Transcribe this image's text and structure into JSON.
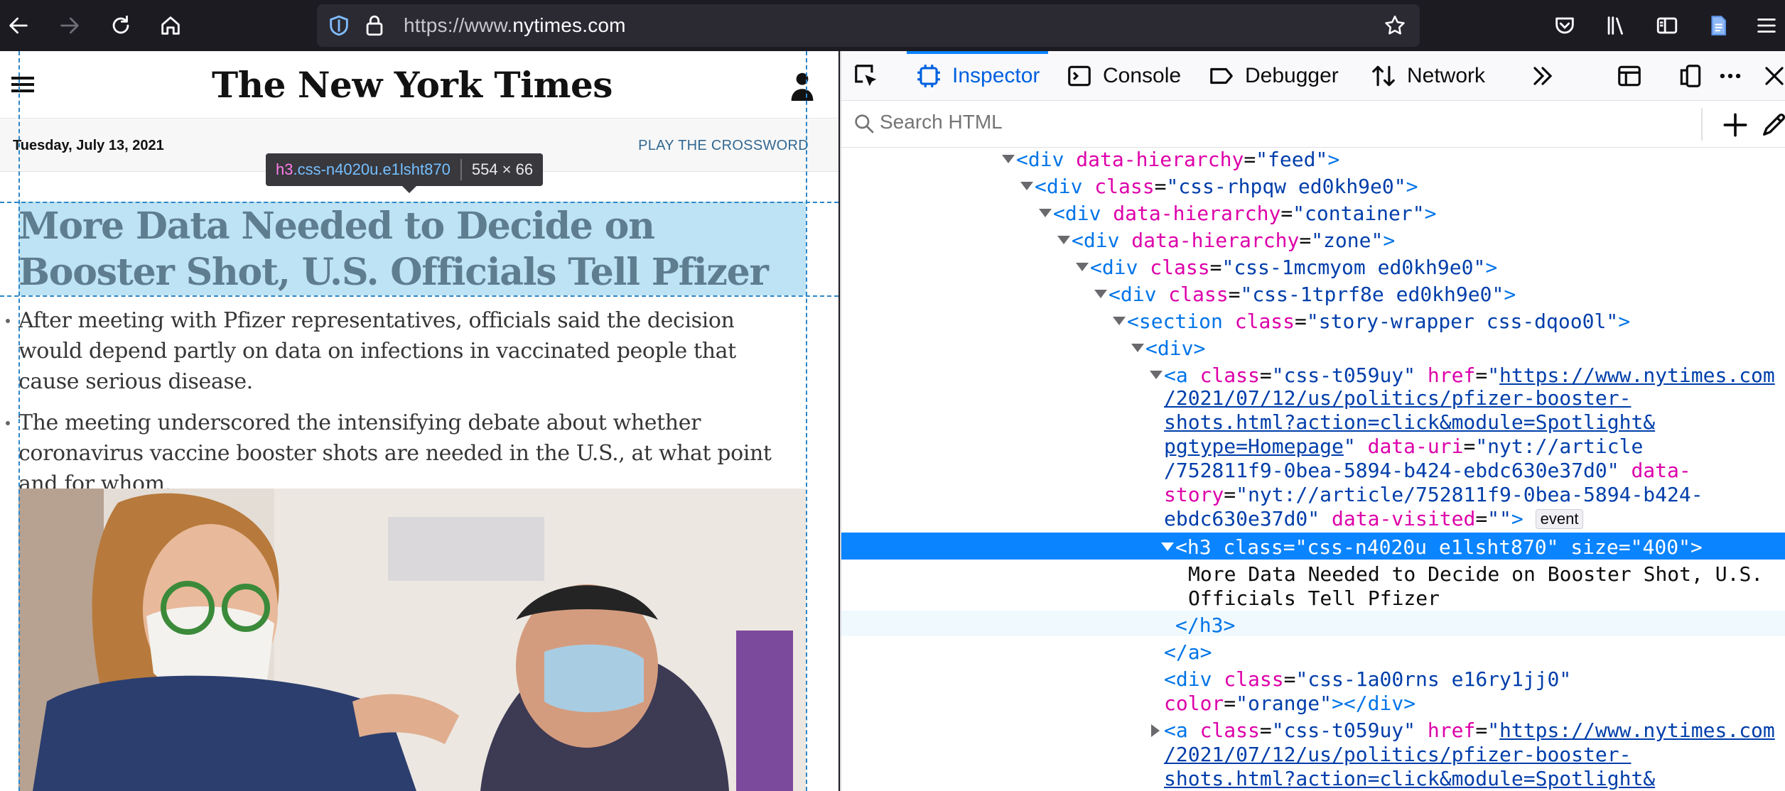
{
  "browser": {
    "url_prefix": "https://www.",
    "url_host": "nytimes.com"
  },
  "page": {
    "logo": "The New York Times",
    "date": "Tuesday, July 13, 2021",
    "crossword_link": "PLAY THE CROSSWORD",
    "headline": "More Data Needed to Decide on Booster Shot, U.S. Officials Tell Pfizer",
    "summary_1": "After meeting with Pfizer representatives, officials said the decision would depend partly on data on infections in vaccinated people that cause serious disease.",
    "summary_2": "The meeting underscored the intensifying debate about whether coronavirus vaccine booster shots are needed in the U.S., at what point and for whom."
  },
  "inspector_tooltip": {
    "tag": "h3",
    "class": ".css-n4020u.e1lsht870",
    "dimensions": "554 × 66"
  },
  "devtools": {
    "tabs": {
      "inspector": "Inspector",
      "console": "Console",
      "debugger": "Debugger",
      "network": "Network"
    },
    "search_placeholder": "Search HTML",
    "tree": {
      "n1": {
        "tag": "div",
        "a1": "data-hierarchy",
        "v1": "feed"
      },
      "n2": {
        "tag": "div",
        "a1": "class",
        "v1": "css-rhpqw ed0kh9e0"
      },
      "n3": {
        "tag": "div",
        "a1": "data-hierarchy",
        "v1": "container"
      },
      "n4": {
        "tag": "div",
        "a1": "data-hierarchy",
        "v1": "zone"
      },
      "n5": {
        "tag": "div",
        "a1": "class",
        "v1": "css-1mcmyom ed0kh9e0"
      },
      "n6": {
        "tag": "div",
        "a1": "class",
        "v1": "css-1tprf8e ed0kh9e0"
      },
      "n7": {
        "tag": "section",
        "a1": "class",
        "v1": "story-wrapper css-dqoo0l"
      },
      "n8": {
        "tag": "div"
      },
      "n9": {
        "tag": "a",
        "a1": "class",
        "v1": "css-t059uy",
        "a2": "href",
        "href_1": "https://www.nytimes.com",
        "href_2": "/2021/07/12/us/politics/pfizer-booster-",
        "href_3": "shots.html?action=click&module=Spotlight&",
        "href_4": "pgtype=Homepage",
        "a3": "data-uri",
        "uri_1": "nyt://article",
        "uri_2": "/752811f9-0bea-5894-b424-ebdc630e37d0",
        "a4_1": "data-",
        "a4_2": "story",
        "story_1": "nyt://article/752811f9-0bea-5894-b424-",
        "story_2": "ebdc630e37d0",
        "a5": "data-visited",
        "v5": "",
        "badge": "event"
      },
      "n10": {
        "tag": "h3",
        "a1": "class",
        "v1": "css-n4020u e1lsht870",
        "a2": "size",
        "v2": "400"
      },
      "n10_text_1": "More Data Needed to Decide on Booster Shot, U.S.",
      "n10_text_2": "Officials Tell Pfizer",
      "n10_close": "h3",
      "n9_close": "a",
      "n11": {
        "tag": "div",
        "a1": "class",
        "v1": "css-1a00rns e16ry1jj0",
        "a2": "color",
        "v2": "orange",
        "close": "div"
      },
      "n12": {
        "tag": "a",
        "a1": "class",
        "v1": "css-t059uy",
        "a2": "href",
        "href_1": "https://www.nytimes.com",
        "href_2": "/2021/07/12/us/politics/pfizer-booster-",
        "href_3": "shots.html?action=click&module=Spotlight&"
      }
    }
  },
  "colors": {
    "selection": "#0a84ff",
    "headline_highlight": "#bde3f4",
    "tag": "#0074e8",
    "attribute": "#dd00a9",
    "value": "#003eaa"
  }
}
